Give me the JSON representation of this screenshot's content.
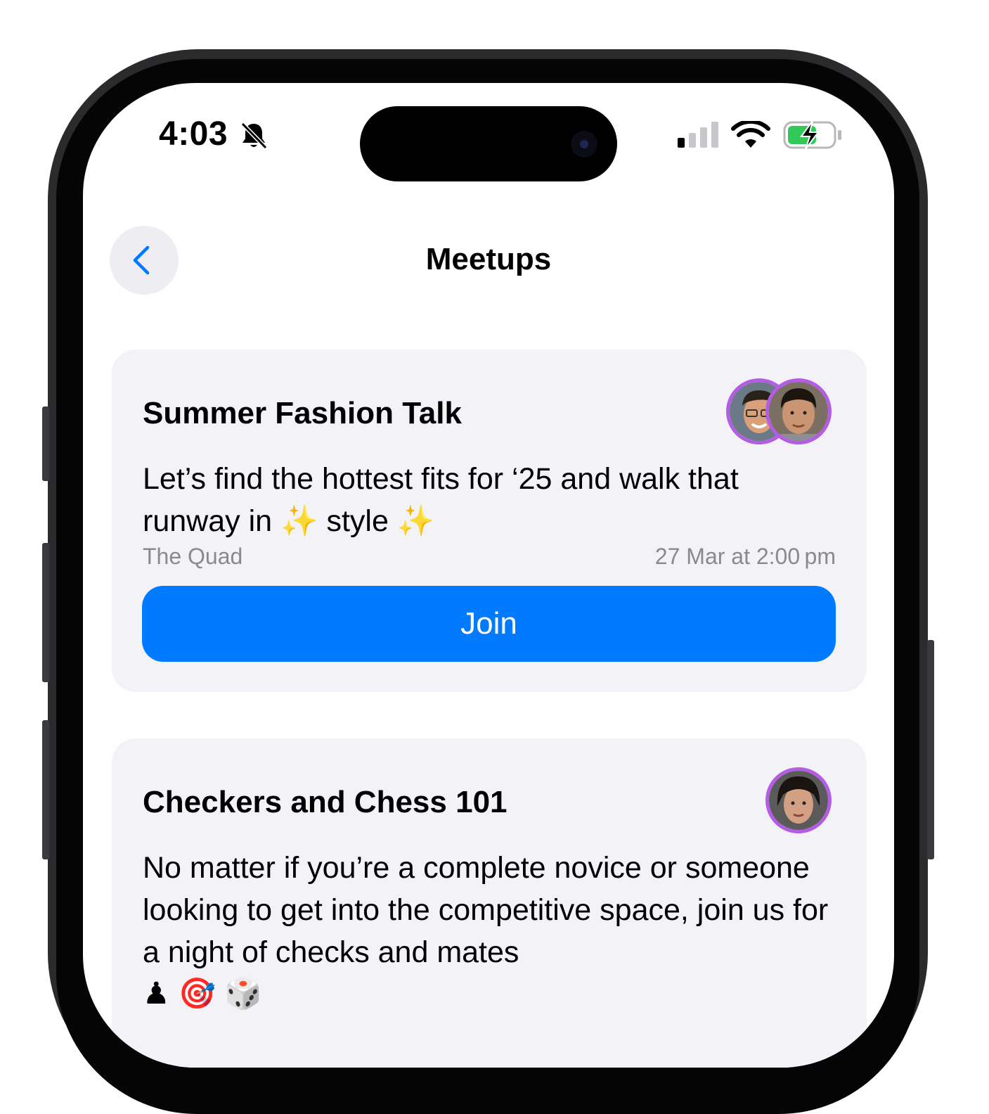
{
  "status_bar": {
    "time": "4:03",
    "icons": [
      "bell-slash-icon",
      "signal-icon",
      "wifi-icon",
      "battery-charging-icon"
    ]
  },
  "nav": {
    "back_icon": "chevron-left-icon",
    "title": "Meetups"
  },
  "meetups": [
    {
      "title": "Summer Fashion Talk",
      "description_part1": "Let’s find the hottest fits for ‘25 and walk that runway in ",
      "emoji1": "✨",
      "description_part2": " style ",
      "emoji2": "✨",
      "location": "The Quad",
      "datetime": "27 Mar at 2:00 pm",
      "join_label": "Join",
      "avatar_count": 2
    },
    {
      "title": "Checkers and Chess 101",
      "description": "No matter if you’re a complete novice or someone looking to get into the competitive space, join us for a night of checks and mates",
      "emojis": "♟ 🎯 🎲",
      "avatar_count": 1
    }
  ],
  "colors": {
    "accent": "#007aff",
    "card_background": "#f2f2f7",
    "avatar_ring": "#b45ce4",
    "battery_fill": "#34c759"
  }
}
